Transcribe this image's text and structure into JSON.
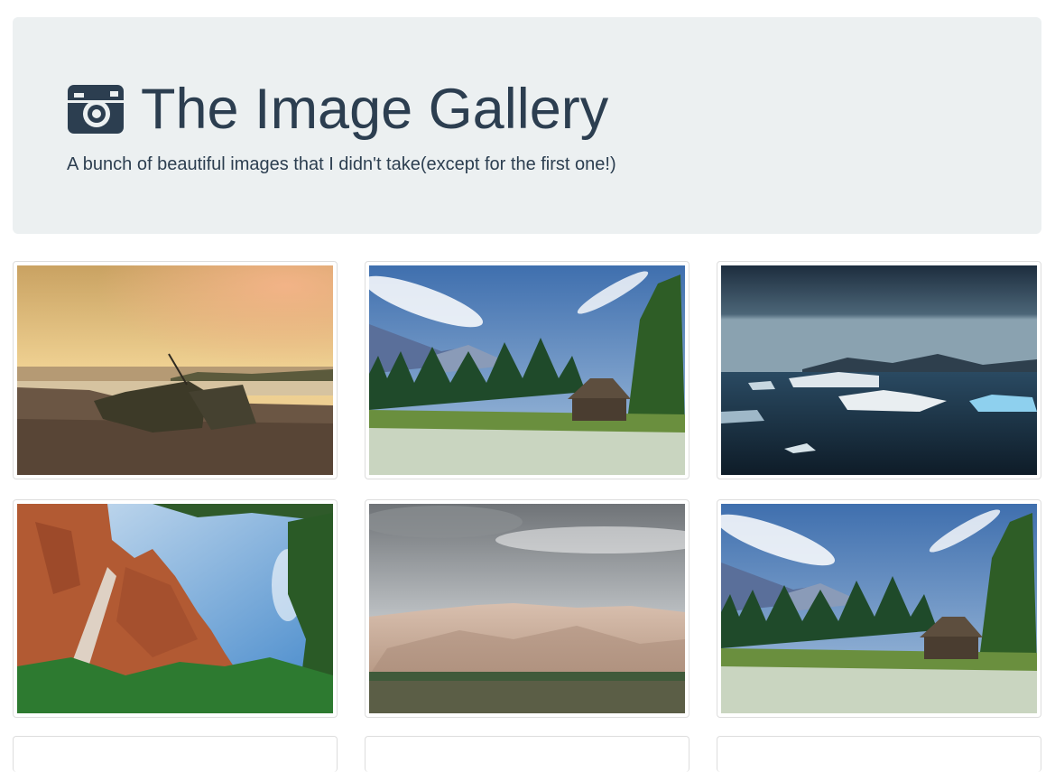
{
  "header": {
    "icon": "camera-icon",
    "title": "The Image Gallery",
    "subtitle": "A bunch of beautiful images that I didn't take(except for the first one!)"
  },
  "gallery": {
    "images": [
      {
        "subject": "shipwreck-sunset"
      },
      {
        "subject": "hut-in-meadow"
      },
      {
        "subject": "icebergs-lake"
      },
      {
        "subject": "canyon-waterfall"
      },
      {
        "subject": "sand-dunes"
      },
      {
        "subject": "hut-in-meadow"
      }
    ]
  }
}
